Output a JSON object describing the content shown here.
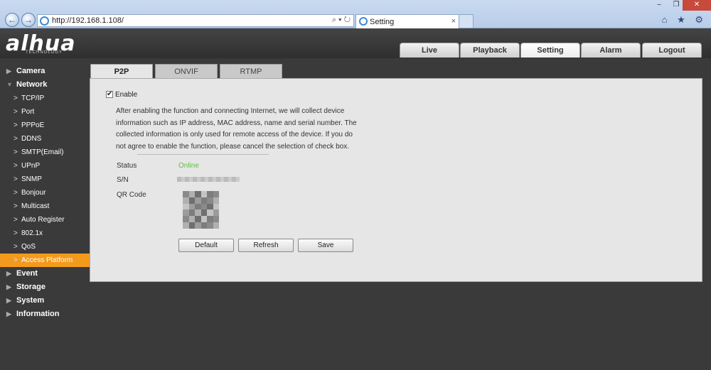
{
  "browser": {
    "url": "http://192.168.1.108/",
    "tab_title": "Setting",
    "tab_close": "×",
    "addr_tools": "⌕ ▾ ↻",
    "right_icons": "⌂ ★ ⚙",
    "win_minimize": "–",
    "win_restore": "❐",
    "win_close": "✕",
    "back": "←",
    "forward": "→"
  },
  "app": {
    "logo": "alhua",
    "logo_sub": "TECHNOLOGY",
    "main_nav": [
      {
        "label": "Live"
      },
      {
        "label": "Playback"
      },
      {
        "label": "Setting"
      },
      {
        "label": "Alarm"
      },
      {
        "label": "Logout"
      }
    ]
  },
  "sidebar": {
    "items": [
      {
        "label": "Camera",
        "arrow": "▶"
      },
      {
        "label": "Network",
        "arrow": "▼"
      },
      {
        "label": "TCP/IP",
        "arrow": ">"
      },
      {
        "label": "Port",
        "arrow": ">"
      },
      {
        "label": "PPPoE",
        "arrow": ">"
      },
      {
        "label": "DDNS",
        "arrow": ">"
      },
      {
        "label": "SMTP(Email)",
        "arrow": ">"
      },
      {
        "label": "UPnP",
        "arrow": ">"
      },
      {
        "label": "SNMP",
        "arrow": ">"
      },
      {
        "label": "Bonjour",
        "arrow": ">"
      },
      {
        "label": "Multicast",
        "arrow": ">"
      },
      {
        "label": "Auto Register",
        "arrow": ">"
      },
      {
        "label": "802.1x",
        "arrow": ">"
      },
      {
        "label": "QoS",
        "arrow": ">"
      },
      {
        "label": "Access Platform",
        "arrow": ">"
      },
      {
        "label": "Event",
        "arrow": "▶"
      },
      {
        "label": "Storage",
        "arrow": "▶"
      },
      {
        "label": "System",
        "arrow": "▶"
      },
      {
        "label": "Information",
        "arrow": "▶"
      }
    ]
  },
  "content": {
    "tabs": [
      {
        "label": "P2P"
      },
      {
        "label": "ONVIF"
      },
      {
        "label": "RTMP"
      }
    ],
    "enable_label": "Enable",
    "enable_check": "✔",
    "notice": "After enabling the function and connecting Internet, we will collect device information such as IP address, MAC address, name and serial number. The collected information is only used for remote access of the device. If you do not agree to enable the function, please cancel the selection of check box.",
    "status_label": "Status",
    "status_value": "Online",
    "status_color": "#5ac23a",
    "sn_label": "S/N",
    "qr_label": "QR Code",
    "buttons": {
      "default": "Default",
      "refresh": "Refresh",
      "save": "Save"
    }
  }
}
